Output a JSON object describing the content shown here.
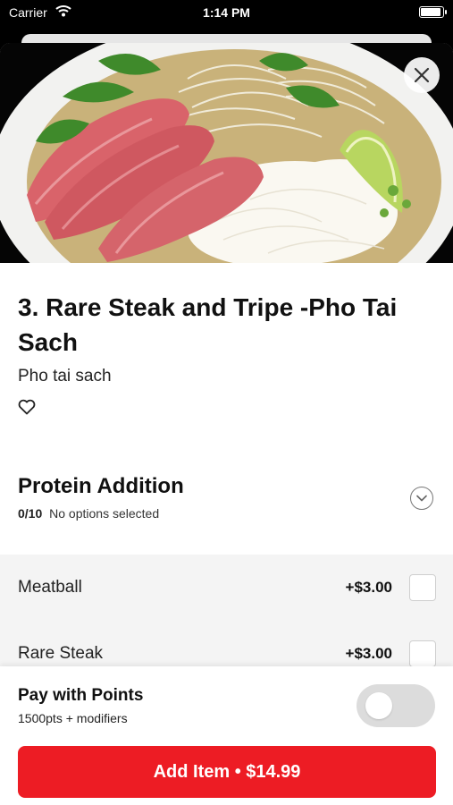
{
  "status_bar": {
    "carrier": "Carrier",
    "time": "1:14 PM",
    "icons": [
      "wifi-icon",
      "battery-icon"
    ]
  },
  "item": {
    "image_icon": "pho-bowl-image",
    "close_icon": "close-icon",
    "title": "3. Rare Steak and Tripe -Pho Tai Sach",
    "description": "Pho tai sach",
    "favorite_icon": "heart-outline-icon"
  },
  "modifier_group": {
    "title": "Protein Addition",
    "count": "0/10",
    "status": "No options selected",
    "expand_icon": "chevron-down-icon",
    "options": [
      {
        "name": "Meatball",
        "price": "+$3.00",
        "selected": false
      },
      {
        "name": "Rare Steak",
        "price": "+$3.00",
        "selected": false
      }
    ]
  },
  "points": {
    "title": "Pay with Points",
    "subtitle": "1500pts + modifiers",
    "enabled": false
  },
  "cta": {
    "label": "Add Item • $14.99"
  },
  "colors": {
    "accent": "#ed1c24",
    "toggle_off": "#dcdcdc",
    "options_background": "#f4f4f4"
  }
}
